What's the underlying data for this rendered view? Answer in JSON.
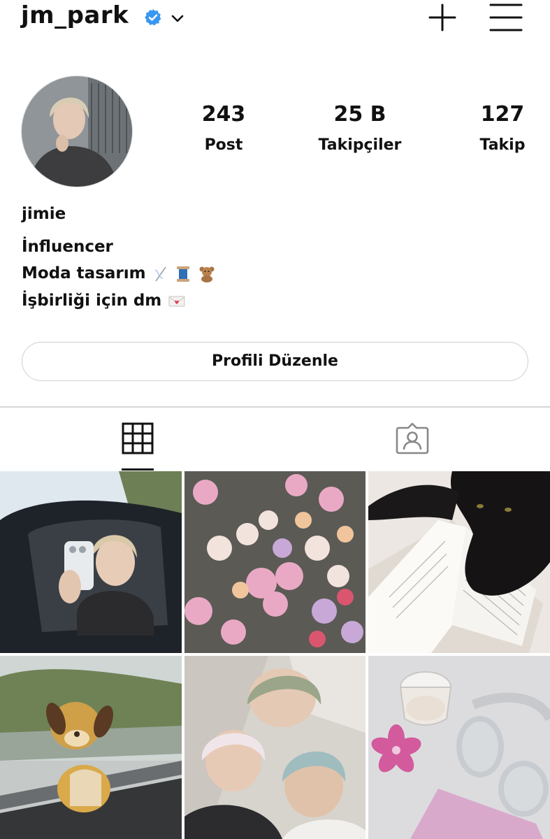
{
  "profile": {
    "username": "jm_park",
    "verified": true,
    "display_name": "jimie",
    "bio": {
      "line1": "İnfluencer",
      "line2": "Moda tasarım",
      "line2_emojis": [
        "thread-needle",
        "spool",
        "teddy-bear"
      ],
      "line3": "İşbirliği için dm",
      "line3_emojis": [
        "love-letter"
      ]
    }
  },
  "stats": {
    "posts": {
      "value": "243",
      "label": "Post"
    },
    "followers": {
      "value": "25 B",
      "label": "Takipçiler"
    },
    "following": {
      "value": "127",
      "label": "Takip"
    }
  },
  "actions": {
    "edit_profile_label": "Profili Düzenle"
  },
  "icons": {
    "verified": "verified-badge-icon",
    "dropdown": "chevron-down-icon",
    "create": "plus-icon",
    "menu": "hamburger-menu-icon",
    "grid_tab": "grid-icon",
    "tagged_tab": "tagged-person-icon"
  },
  "colors": {
    "verified_blue": "#3897f0",
    "text": "#111111",
    "border": "#cfcfcf"
  },
  "posts": [
    {
      "subject": "car-selfie"
    },
    {
      "subject": "flowers"
    },
    {
      "subject": "black-cat-book"
    },
    {
      "subject": "plush-train-window"
    },
    {
      "subject": "group-selfie"
    },
    {
      "subject": "headphones-drink"
    }
  ]
}
